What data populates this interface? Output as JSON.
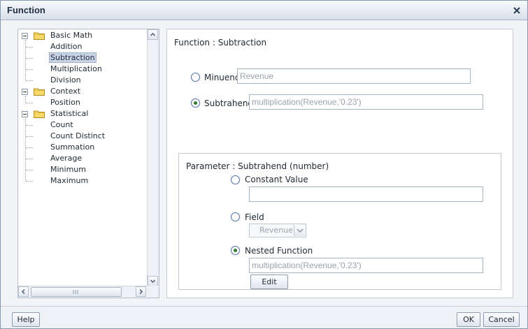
{
  "dialog": {
    "title": "Function"
  },
  "tree": {
    "groups": [
      {
        "label": "Basic Math",
        "items": [
          "Addition",
          "Subtraction",
          "Multiplication",
          "Division"
        ]
      },
      {
        "label": "Context",
        "items": [
          "Position"
        ]
      },
      {
        "label": "Statistical",
        "items": [
          "Count",
          "Count Distinct",
          "Summation",
          "Average",
          "Minimum",
          "Maximum"
        ]
      }
    ],
    "selected": "Subtraction"
  },
  "main": {
    "function_title": "Function : Subtraction",
    "minuend": {
      "label": "Minuend",
      "value": "Revenue",
      "checked": false
    },
    "subtrahend": {
      "label": "Subtrahend",
      "value": "multiplication(Revenue,'0.23')",
      "checked": true
    }
  },
  "parameter": {
    "title": "Parameter : Subtrahend (number)",
    "constant": {
      "label": "Constant Value",
      "value": "",
      "checked": false
    },
    "field": {
      "label": "Field",
      "value": "Revenue",
      "checked": false
    },
    "nested": {
      "label": "Nested Function",
      "value": "multiplication(Revenue,'0.23')",
      "checked": true
    },
    "edit_label": "Edit"
  },
  "footer": {
    "help_label": "Help",
    "ok_label": "OK",
    "cancel_label": "Cancel"
  },
  "colors": {
    "title_gradient_top": "#f7f9fc",
    "selected_bg": "#c9d3e6",
    "radio_dot": "#2d7b2d"
  }
}
